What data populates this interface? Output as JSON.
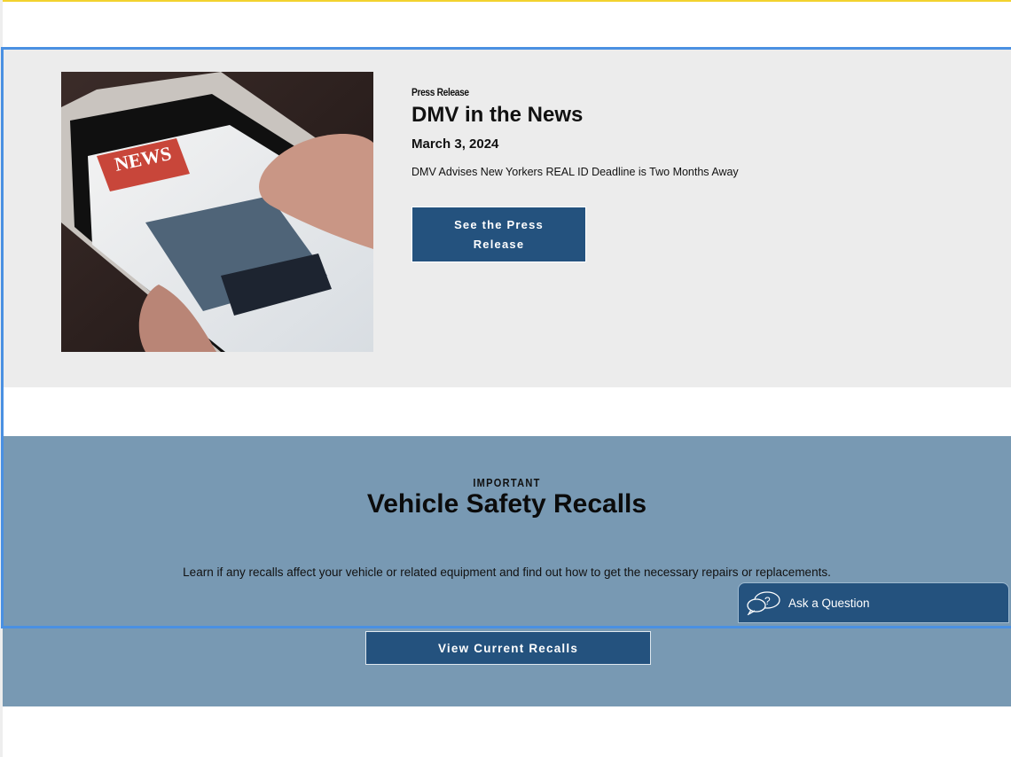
{
  "news": {
    "eyebrow": "Press Release",
    "title": "DMV in the News",
    "date": "March 3, 2024",
    "description": "DMV Advises New Yorkers REAL ID Deadline is Two Months Away",
    "button_label": "See the Press Release",
    "image_text": "NEWS"
  },
  "recalls": {
    "eyebrow": "IMPORTANT",
    "title": "Vehicle Safety Recalls",
    "description": "Learn if any recalls affect your vehicle or related equipment and find out how to get the necessary repairs or replacements.",
    "button_label": "View Current Recalls"
  },
  "chat_widget": {
    "label": "Ask a Question",
    "icon": "chat-bubbles-question-icon"
  },
  "colors": {
    "button_blue": "#24527e",
    "news_bg": "#ececec",
    "recall_bg": "#7899b3",
    "top_accent": "#f2d22e",
    "focus_outline": "#4a90e2"
  }
}
